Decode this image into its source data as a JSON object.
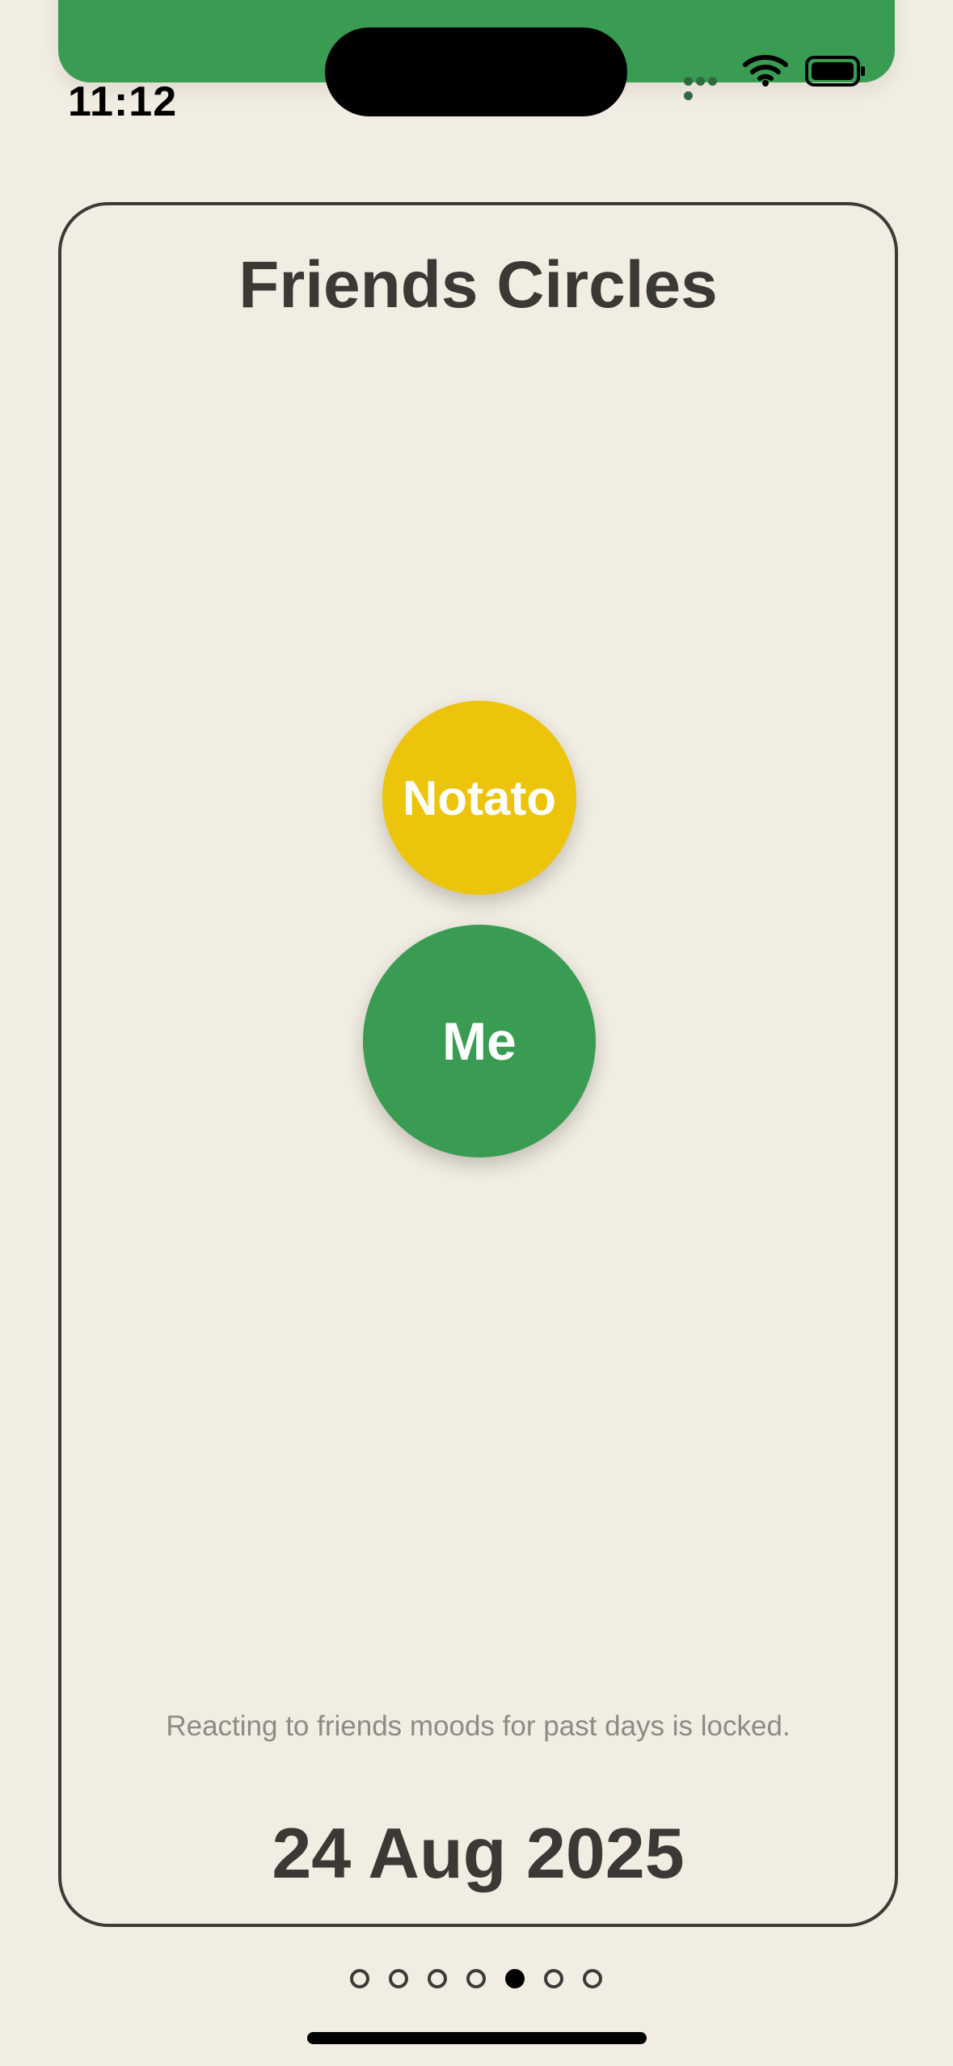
{
  "status_bar": {
    "time": "11:12",
    "background_color": "#3a9c53",
    "icons": [
      "cellular-signal-icon",
      "wifi-icon",
      "battery-icon"
    ]
  },
  "card": {
    "title": "Friends Circles",
    "friends": [
      {
        "label": "Notato",
        "color": "#ebc40b"
      },
      {
        "label": "Me",
        "color": "#3a9c53"
      }
    ],
    "locked_note": "Reacting to friends moods for past days is locked.",
    "date": "24 Aug 2025"
  },
  "pagination": {
    "total_pages": 7,
    "active_page": 5
  }
}
